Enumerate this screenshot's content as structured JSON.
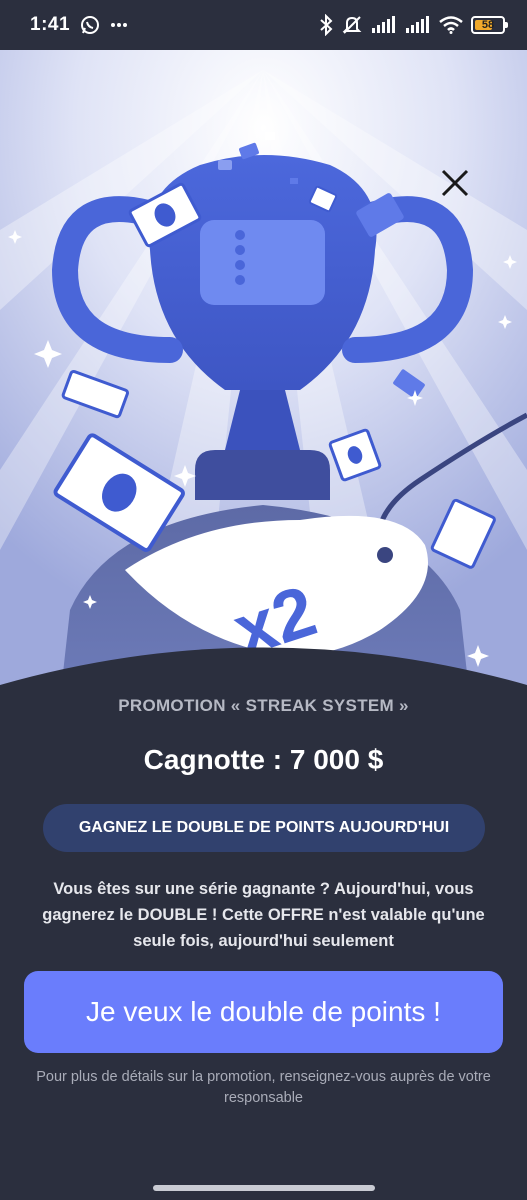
{
  "status_bar": {
    "time": "1:41",
    "battery_level": "58",
    "icons": [
      "whatsapp-icon",
      "more-dots-icon",
      "bluetooth-icon",
      "muted-icon",
      "signal-icon",
      "signal-icon",
      "wifi-icon",
      "battery-icon"
    ]
  },
  "hero": {
    "badge_text": "x2",
    "close_icon": "close-icon"
  },
  "promo": {
    "label": "PROMOTION « STREAK SYSTEM »",
    "jackpot": "Cagnotte : 7 000 $",
    "pill_text": "GAGNEZ LE DOUBLE DE POINTS AUJOURD'HUI",
    "description": "Vous êtes sur une série gagnante ? Aujourd'hui, vous gagnerez le DOUBLE ! Cette OFFRE n'est valable qu'une seule fois, aujourd'hui seulement",
    "cta_label": "Je veux le double de points !",
    "footnote": "Pour plus de détails sur la promotion, renseignez-vous auprès de votre responsable"
  },
  "colors": {
    "background": "#2b2f3e",
    "accent": "#6a7dfc",
    "pill_bg": "#31416e",
    "trophy": "#4a66d9"
  }
}
